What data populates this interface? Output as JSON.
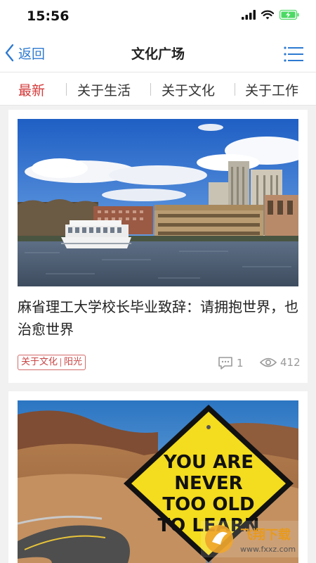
{
  "status": {
    "time": "15:56"
  },
  "nav": {
    "back_label": "返回",
    "title": "文化广场"
  },
  "tabs": [
    "最新",
    "关于生活",
    "关于文化",
    "关于工作"
  ],
  "cards": [
    {
      "title": "麻省理工大学校长毕业致辞：请拥抱世界，也治愈世界",
      "tag_left": "关于文化",
      "tag_right": "阳光",
      "comments": "1",
      "views": "412"
    },
    {
      "sign_lines": [
        "YOU ARE",
        "NEVER",
        "TOO OLD",
        "TO LEARN"
      ]
    }
  ],
  "watermark": {
    "brand": "飞翔下载",
    "url": "www.fxxz.com"
  },
  "colors": {
    "accent_red": "#d43a3a",
    "link_blue": "#2e7ad1",
    "battery_green": "#4cd964"
  }
}
